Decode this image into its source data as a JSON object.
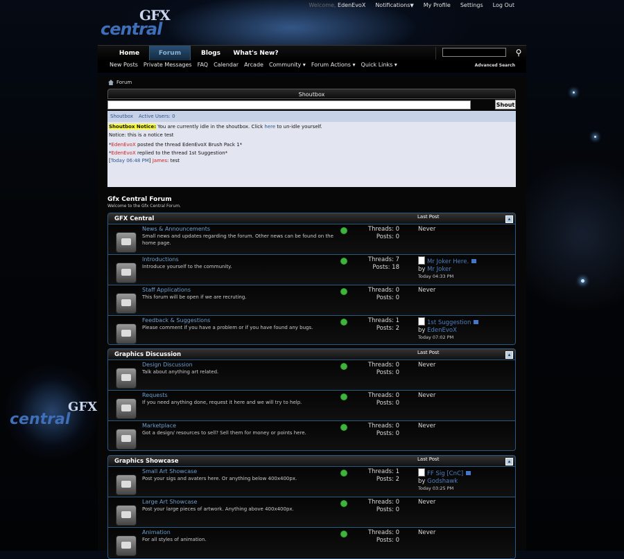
{
  "logo": {
    "gfx": "GFX",
    "central": "central"
  },
  "toplinks": {
    "welcome": "Welcome,",
    "user": "EdenEvoX",
    "notifications": "Notifications",
    "profile": "My Profile",
    "settings": "Settings",
    "logout": "Log Out"
  },
  "nav": {
    "tabs": [
      "Home",
      "Forum",
      "Blogs",
      "What's New?"
    ],
    "active": "Forum"
  },
  "subnav": {
    "items": [
      "New Posts",
      "Private Messages",
      "FAQ",
      "Calendar",
      "Arcade",
      "Community",
      "Forum Actions",
      "Quick Links"
    ],
    "advanced": "Advanced Search"
  },
  "breadcrumb": {
    "label": "Forum"
  },
  "shoutbox": {
    "title": "Shoutbox",
    "button": "Shout",
    "tabs": [
      "Shoutbox",
      "Active Users: 0"
    ],
    "notice_label": "Shoutbox Notice:",
    "notice_pre": " You are currently idle in the shoutbox. Click ",
    "notice_link": "here",
    "notice_post": " to un-idle yourself.",
    "line2": "Notice: this is a notice test",
    "line3_user": "EdenEvoX",
    "line3_text": " posted the thread EdenEvoX Brush Pack 1*",
    "line4_user": "EdenEvoX",
    "line4_text": " replied to the thread 1st Suggestion*",
    "line5_time": "Today 06:48 PM",
    "line5_user": "James",
    "line5_text": ": test"
  },
  "forum": {
    "title": "Gfx Central Forum",
    "subtitle": "Welcome to the Gfx Central Forum."
  },
  "categories": [
    {
      "name": "GFX Central",
      "last_post_label": "Last Post",
      "forums": [
        {
          "name": "News & Announcements",
          "desc": "Small news and updates regarding the forum. Other news can be found on the home page.",
          "threads": "Threads: 0",
          "posts": "Posts: 0",
          "last": "Never"
        },
        {
          "name": "Introductions",
          "desc": "Introduce yourself to the community.",
          "threads": "Threads: 7",
          "posts": "Posts: 18",
          "last_title": "Mr Joker Here.",
          "by": "by",
          "last_user": "Mr Joker",
          "last_date": "Today 04:33 PM"
        },
        {
          "name": "Staff Applications",
          "desc": "This forum will be open if we are recruting.",
          "threads": "Threads: 0",
          "posts": "Posts: 0",
          "last": "Never"
        },
        {
          "name": "Feedback & Suggestions",
          "desc": "Please comment if you have a problem or if you have found any bugs.",
          "threads": "Threads: 1",
          "posts": "Posts: 2",
          "last_title": "1st Suggestion",
          "by": "by",
          "last_user": "EdenEvoX",
          "last_date": "Today 07:02 PM"
        }
      ]
    },
    {
      "name": "Graphics Discussion",
      "last_post_label": "Last Post",
      "forums": [
        {
          "name": "Design Discussion",
          "desc": "Talk about anything art related.",
          "threads": "Threads: 0",
          "posts": "Posts: 0",
          "last": "Never"
        },
        {
          "name": "Requests",
          "desc": "If you need anything done, request it here and we will try to help.",
          "threads": "Threads: 0",
          "posts": "Posts: 0",
          "last": "Never"
        },
        {
          "name": "Marketplace",
          "desc": "Got a design/ resources to sell? Sell them for money or points here.",
          "threads": "Threads: 0",
          "posts": "Posts: 0",
          "last": "Never"
        }
      ]
    },
    {
      "name": "Graphics Showcase",
      "last_post_label": "Last Post",
      "forums": [
        {
          "name": "Small Art Showcase",
          "desc": "Post your sigs and avaters here. Or anything below 400x400px.",
          "threads": "Threads: 1",
          "posts": "Posts: 2",
          "last_title": "FF Sig [CnC]",
          "by": "by",
          "last_user": "Godshawk",
          "last_date": "Today 03:25 PM"
        },
        {
          "name": "Large Art Showcase",
          "desc": "Post your large pieces of artwork. Anything above 400x400px.",
          "threads": "Threads: 0",
          "posts": "Posts: 0",
          "last": "Never"
        },
        {
          "name": "Animation",
          "desc": "For all styles of animation.",
          "threads": "Threads: 0",
          "posts": "Posts: 0",
          "last": "Never"
        }
      ]
    }
  ]
}
